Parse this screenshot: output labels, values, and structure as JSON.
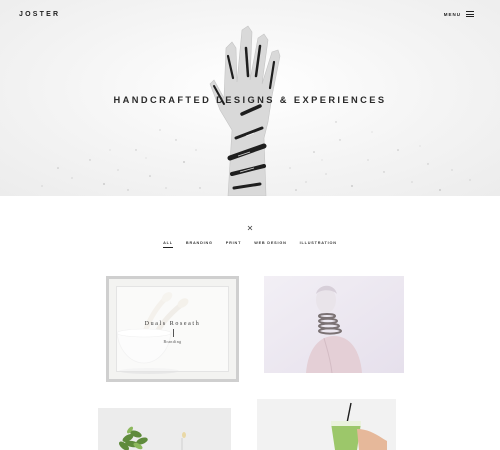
{
  "header": {
    "logo": "JOSTER",
    "menu_label": "MENU"
  },
  "hero": {
    "title": "HANDCRAFTED DESIGNS & EXPERIENCES",
    "artwork_icon": "lettered-hand-illustration"
  },
  "filters": {
    "items": [
      {
        "label": "ALL",
        "active": true
      },
      {
        "label": "BRANDING",
        "active": false
      },
      {
        "label": "PRINT",
        "active": false
      },
      {
        "label": "WEB DESIGN",
        "active": false
      },
      {
        "label": "ILLUSTRATION",
        "active": false
      }
    ]
  },
  "portfolio": {
    "items": [
      {
        "title": "Duals Roseath",
        "category": "Branding"
      }
    ]
  },
  "icons": {
    "close": "close-icon",
    "menu": "hamburger-icon"
  },
  "colors": {
    "text": "#222222",
    "hero_bg": "#f4f4f4",
    "card_border": "#cfcfcf"
  }
}
